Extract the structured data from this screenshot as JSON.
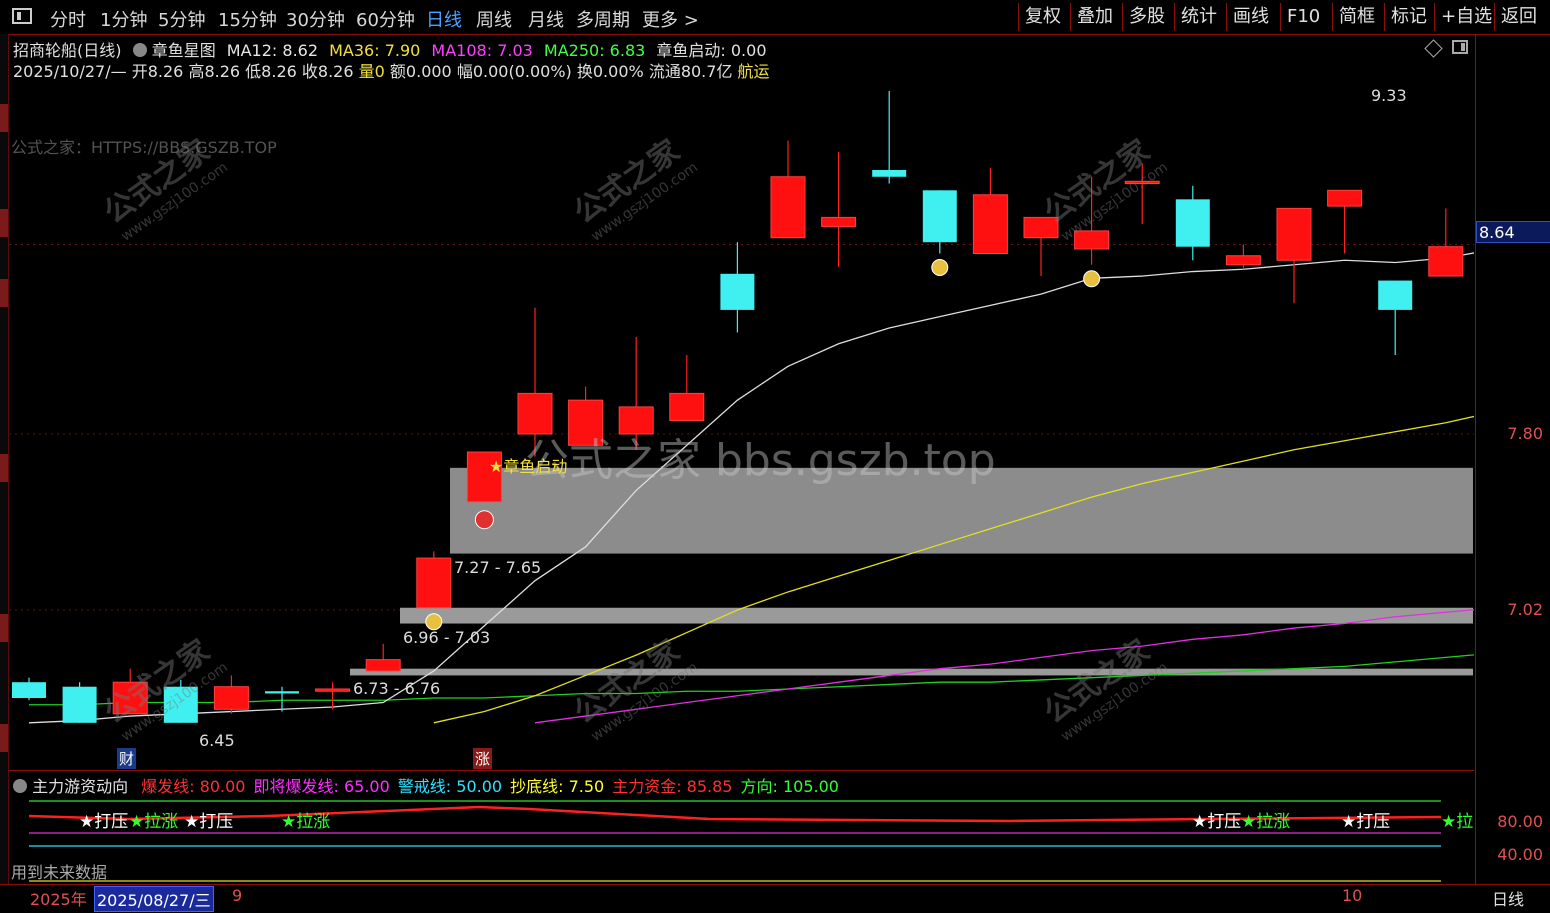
{
  "toolbar": {
    "periods": [
      "分时",
      "1分钟",
      "5分钟",
      "15分钟",
      "30分钟",
      "60分钟",
      "日线",
      "周线",
      "月线",
      "多周期",
      "更多 >"
    ],
    "active_period": "日线",
    "right_buttons": [
      "复权",
      "叠加",
      "多股",
      "统计",
      "画线",
      "F10",
      "简框",
      "标记",
      "+自选",
      "返回"
    ]
  },
  "header": {
    "stock": "招商轮船(日线)",
    "indicator": "章鱼星图",
    "ma12": "MA12: 8.62",
    "ma36": "MA36: 7.90",
    "ma108": "MA108: 7.03",
    "ma250": "MA250: 6.83",
    "start": "章鱼启动: 0.00",
    "date": "2025/10/27/—",
    "open": "开8.26",
    "high": "高8.26",
    "low": "低8.26",
    "close": "收8.26",
    "vol": "量0",
    "amount": "额0.000",
    "change": "幅0.00(0.00%)",
    "turnover": "换0.00%",
    "float": "流通80.7亿",
    "sector": "航运"
  },
  "watermark_text": "公式之家：HTTPS://BBS.GSZB.TOP",
  "center_watermark": "公式之家 bbs.gszb.top",
  "annotations": {
    "high_label": "9.33",
    "low_label": "6.45",
    "zone1": "7.27 - 7.65",
    "zone2": "6.96 - 7.03",
    "zone3": "6.73 - 6.76",
    "signal": "★章鱼启动",
    "badge_cai": "财",
    "badge_zhang": "涨"
  },
  "axis": {
    "price_tag": "8.64",
    "labels": [
      "7.80",
      "7.02"
    ],
    "sub_labels": [
      "80.00",
      "40.00"
    ]
  },
  "sub": {
    "title": "主力游资动向",
    "legend": [
      {
        "text": "爆发线: 80.00",
        "color": "#ff3030"
      },
      {
        "text": "即将爆发线: 65.00",
        "color": "#ff30ff"
      },
      {
        "text": "警戒线: 50.00",
        "color": "#30e0ff"
      },
      {
        "text": "抄底线: 7.50",
        "color": "#ffff30"
      },
      {
        "text": "主力资金: 85.85",
        "color": "#ff3030"
      },
      {
        "text": "方向: 105.00",
        "color": "#30ff30"
      }
    ],
    "signals": [
      "★打压",
      "★拉涨",
      "★打压",
      "★拉涨",
      "★打压",
      "★拉涨",
      "★打压",
      "★拉"
    ],
    "footer": "用到未来数据"
  },
  "bottom": {
    "year": "2025年",
    "date_box": "2025/08/27/三",
    "m9": "9",
    "m10": "10",
    "period": "日线"
  },
  "chart_data": {
    "type": "candlestick",
    "ylim": [
      6.3,
      9.6
    ],
    "candles": [
      {
        "o": 6.7,
        "h": 6.72,
        "l": 6.62,
        "c": 6.63
      },
      {
        "o": 6.68,
        "h": 6.7,
        "l": 6.52,
        "c": 6.52
      },
      {
        "o": 6.56,
        "h": 6.76,
        "l": 6.56,
        "c": 6.7
      },
      {
        "o": 6.68,
        "h": 6.71,
        "l": 6.52,
        "c": 6.52
      },
      {
        "o": 6.58,
        "h": 6.73,
        "l": 6.56,
        "c": 6.68
      },
      {
        "o": 6.66,
        "h": 6.68,
        "l": 6.57,
        "c": 6.65
      },
      {
        "o": 6.66,
        "h": 6.7,
        "l": 6.58,
        "c": 6.67
      },
      {
        "o": 6.75,
        "h": 6.87,
        "l": 6.75,
        "c": 6.8
      },
      {
        "o": 7.03,
        "h": 7.28,
        "l": 7.03,
        "c": 7.25
      },
      {
        "o": 7.5,
        "h": 7.7,
        "l": 7.5,
        "c": 7.72
      },
      {
        "o": 7.8,
        "h": 8.36,
        "l": 7.7,
        "c": 7.98
      },
      {
        "o": 7.75,
        "h": 8.01,
        "l": 7.75,
        "c": 7.95
      },
      {
        "o": 7.8,
        "h": 8.23,
        "l": 7.73,
        "c": 7.92
      },
      {
        "o": 7.86,
        "h": 8.15,
        "l": 7.86,
        "c": 7.98
      },
      {
        "o": 8.51,
        "h": 8.65,
        "l": 8.25,
        "c": 8.35
      },
      {
        "o": 8.67,
        "h": 9.1,
        "l": 8.67,
        "c": 8.94
      },
      {
        "o": 8.72,
        "h": 9.05,
        "l": 8.54,
        "c": 8.76
      },
      {
        "o": 8.97,
        "h": 9.32,
        "l": 8.91,
        "c": 8.94
      },
      {
        "o": 8.88,
        "h": 8.88,
        "l": 8.6,
        "c": 8.65
      },
      {
        "o": 8.6,
        "h": 8.98,
        "l": 8.6,
        "c": 8.86
      },
      {
        "o": 8.67,
        "h": 8.75,
        "l": 8.5,
        "c": 8.76
      },
      {
        "o": 8.62,
        "h": 8.94,
        "l": 8.55,
        "c": 8.7
      },
      {
        "o": 8.91,
        "h": 9.0,
        "l": 8.73,
        "c": 8.92
      },
      {
        "o": 8.84,
        "h": 8.9,
        "l": 8.57,
        "c": 8.63
      },
      {
        "o": 8.55,
        "h": 8.64,
        "l": 8.53,
        "c": 8.59
      },
      {
        "o": 8.57,
        "h": 8.75,
        "l": 8.38,
        "c": 8.8
      },
      {
        "o": 8.81,
        "h": 8.88,
        "l": 8.6,
        "c": 8.88
      },
      {
        "o": 8.48,
        "h": 8.48,
        "l": 8.15,
        "c": 8.35
      },
      {
        "o": 8.5,
        "h": 8.8,
        "l": 8.5,
        "c": 8.63
      },
      {
        "o": 8.78,
        "h": 9.18,
        "l": 8.78,
        "c": 8.94
      }
    ],
    "ma12": [
      6.52,
      6.53,
      6.55,
      6.56,
      6.57,
      6.58,
      6.59,
      6.61,
      6.75,
      6.95,
      7.15,
      7.3,
      7.55,
      7.75,
      7.95,
      8.1,
      8.2,
      8.27,
      8.32,
      8.37,
      8.42,
      8.49,
      8.5,
      8.52,
      8.53,
      8.55,
      8.57,
      8.56,
      8.58,
      8.62
    ],
    "ma36": [
      null,
      null,
      null,
      null,
      null,
      null,
      null,
      null,
      6.52,
      6.57,
      6.64,
      6.73,
      6.82,
      6.92,
      7.02,
      7.1,
      7.17,
      7.24,
      7.31,
      7.38,
      7.45,
      7.52,
      7.58,
      7.63,
      7.68,
      7.73,
      7.77,
      7.81,
      7.85,
      7.9
    ],
    "ma108": [
      null,
      null,
      null,
      null,
      null,
      null,
      null,
      null,
      null,
      null,
      6.52,
      6.55,
      6.58,
      6.61,
      6.64,
      6.67,
      6.7,
      6.73,
      6.76,
      6.78,
      6.81,
      6.84,
      6.86,
      6.89,
      6.91,
      6.94,
      6.96,
      6.99,
      7.01,
      7.03
    ],
    "ma250": [
      6.6,
      6.6,
      6.61,
      6.61,
      6.61,
      6.62,
      6.62,
      6.62,
      6.63,
      6.63,
      6.64,
      6.65,
      6.65,
      6.66,
      6.66,
      6.67,
      6.68,
      6.69,
      6.7,
      6.7,
      6.71,
      6.72,
      6.73,
      6.74,
      6.75,
      6.76,
      6.77,
      6.79,
      6.81,
      6.83
    ],
    "zones": [
      {
        "lo": 7.27,
        "hi": 7.65
      },
      {
        "lo": 6.96,
        "hi": 7.03
      },
      {
        "lo": 6.73,
        "hi": 6.76
      }
    ]
  }
}
